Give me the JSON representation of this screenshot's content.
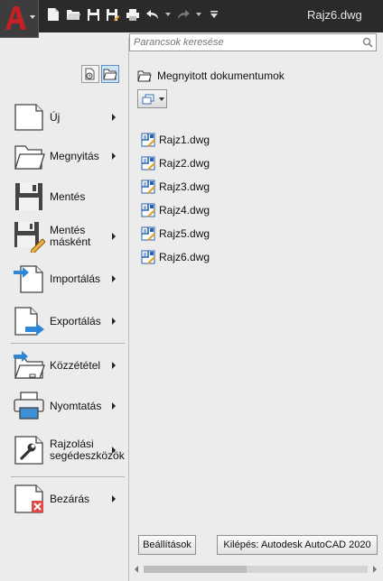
{
  "titlebar": {
    "title": "Rajz6.dwg"
  },
  "quick_access": {
    "icons": [
      "new-file-icon",
      "open-folder-icon",
      "save-icon",
      "save-as-icon",
      "print-icon",
      "undo-icon",
      "redo-icon",
      "customize-icon"
    ]
  },
  "search": {
    "placeholder": "Parancsok keresése"
  },
  "menu": {
    "items": [
      {
        "label": "Új",
        "icon": "new-file-icon"
      },
      {
        "label": "Megnyitás",
        "icon": "open-folder-icon"
      },
      {
        "label": "Mentés",
        "icon": "save-icon"
      },
      {
        "label": "Mentés másként",
        "icon": "save-as-icon"
      },
      {
        "label": "Importálás",
        "icon": "import-icon"
      },
      {
        "label": "Exportálás",
        "icon": "export-icon"
      },
      {
        "label": "Közzététel",
        "icon": "publish-icon"
      },
      {
        "label": "Nyomtatás",
        "icon": "print-icon"
      },
      {
        "label": "Rajzolási segédeszközök",
        "icon": "wrench-icon"
      },
      {
        "label": "Bezárás",
        "icon": "close-document-icon"
      }
    ]
  },
  "recent": {
    "heading": "Megnyitott dokumentumok",
    "files": [
      "Rajz1.dwg",
      "Rajz2.dwg",
      "Rajz3.dwg",
      "Rajz4.dwg",
      "Rajz5.dwg",
      "Rajz6.dwg"
    ]
  },
  "buttons": {
    "options": "Beállítások",
    "exit": "Kilépés: Autodesk AutoCAD 2020"
  },
  "colors": {
    "brand": "#c42126",
    "accent": "#2e86d6"
  }
}
